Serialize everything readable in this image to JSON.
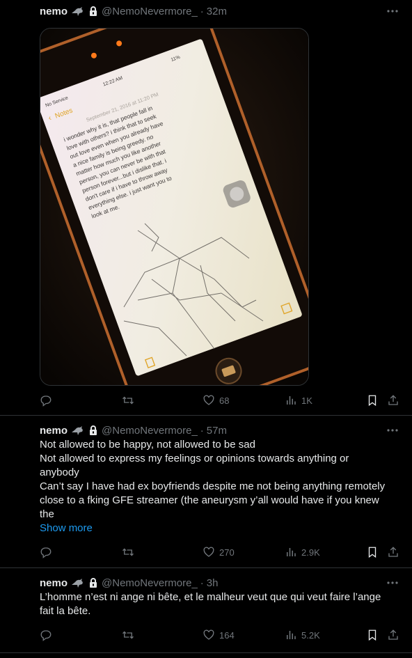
{
  "colors": {
    "background": "#000000",
    "text": "#e7e9ea",
    "muted": "#71767b",
    "link": "#1d9bf0",
    "divider": "#2f3336"
  },
  "tweets": [
    {
      "name": "nemo",
      "handle": "@NemoNevermore_",
      "time": "32m",
      "badge_icon": "crow-icon",
      "lock_icon": "lock-icon",
      "image": {
        "status_left": "No Service",
        "status_time": "12:22 AM",
        "status_battery": "11%",
        "back_label": "Notes",
        "date_line": "September 21, 2016 at 11:20 PM",
        "note_lines": [
          "i wonder why it is, that people fall in",
          "love with others? i think that to seek",
          "out love even when you already have",
          "a nice family is being greedy. no",
          "matter how much you like another",
          "person, you can never be with that",
          "person forever...but i dislike that. i",
          "don't care if i have to throw away",
          "everything else. i just want you to",
          "look at me."
        ]
      },
      "likes": "68",
      "views": "1K"
    },
    {
      "name": "nemo",
      "handle": "@NemoNevermore_",
      "time": "57m",
      "lines": [
        "Not allowed to be happy, not allowed to be sad",
        "Not allowed to express my feelings or opinions towards anything or",
        "anybody",
        "Can’t say I have had ex boyfriends despite me not being anything remotely",
        "close to a fking GFE streamer (the aneurysm y’all would have if you knew",
        "the"
      ],
      "show_more": "Show more",
      "likes": "270",
      "views": "2.9K"
    },
    {
      "name": "nemo",
      "handle": "@NemoNevermore_",
      "time": "3h",
      "lines": [
        "L’homme n’est ni ange ni bête, et le malheur veut que qui veut faire l’ange",
        "fait la bête."
      ],
      "likes": "164",
      "views": "5.2K"
    }
  ]
}
